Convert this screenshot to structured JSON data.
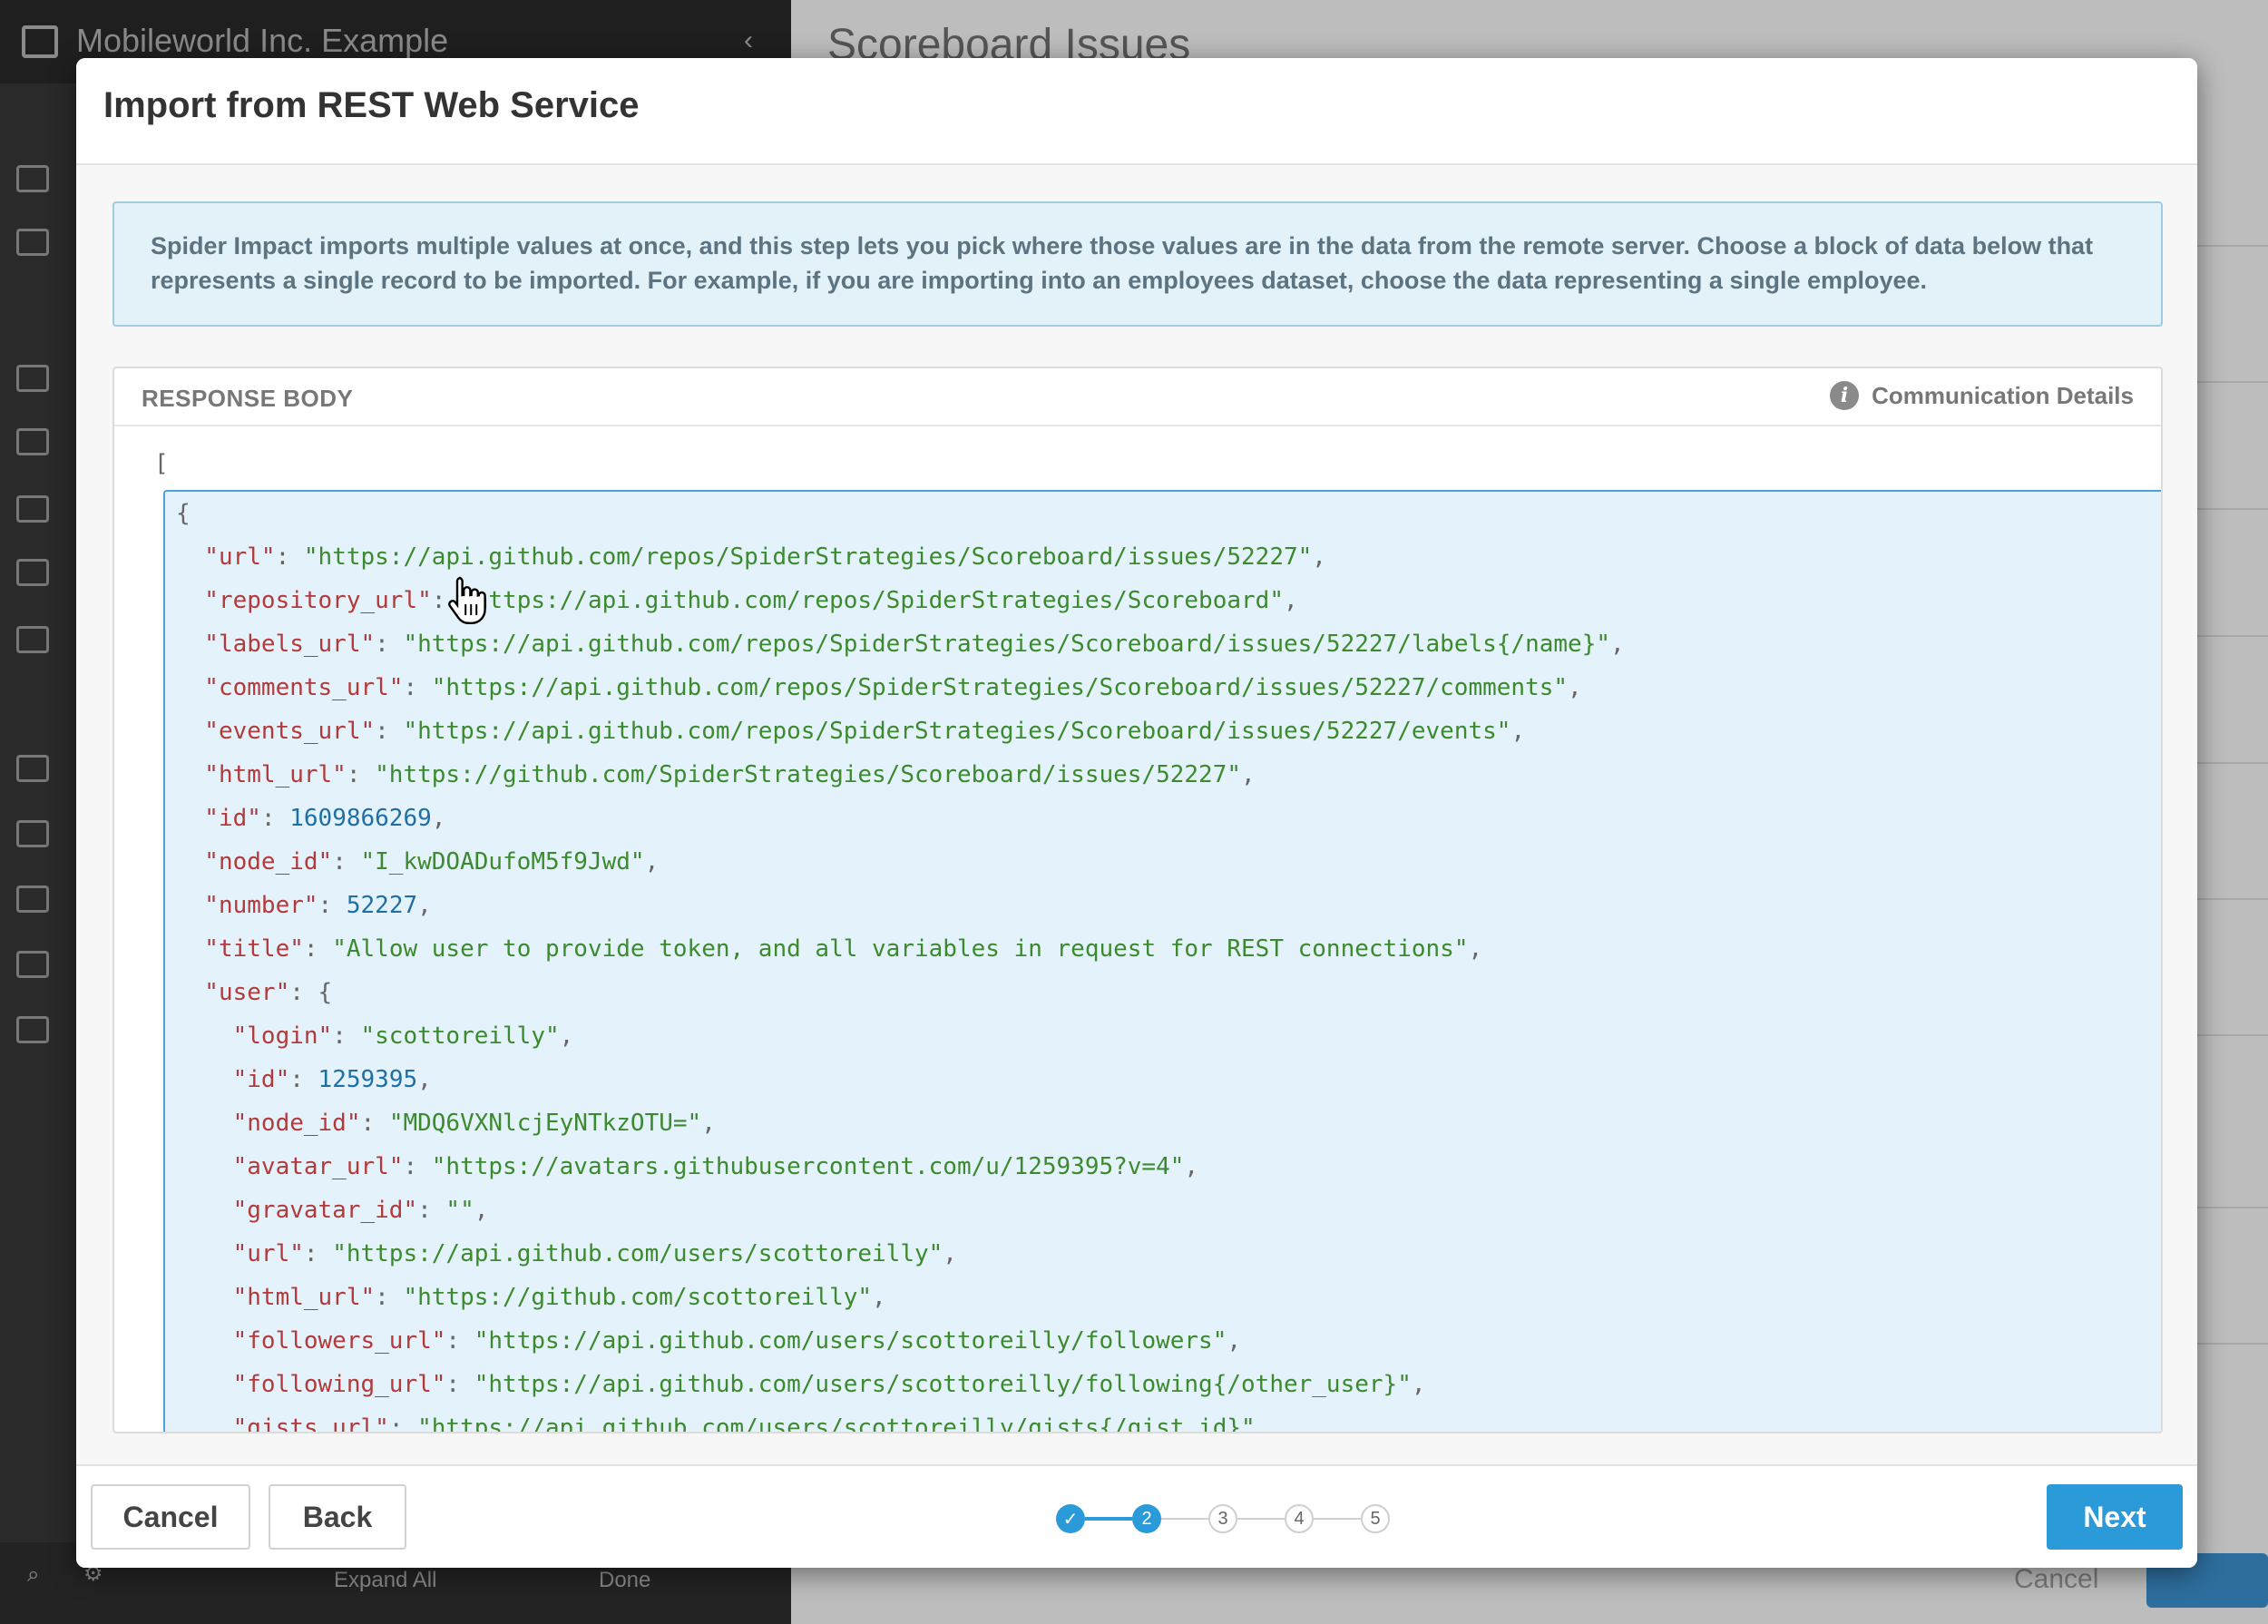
{
  "background": {
    "app_name": "Mobileworld Inc. Example",
    "page_title": "Scoreboard Issues",
    "bottom_bar": {
      "expand_all": "Expand All",
      "done": "Done",
      "cancel": "Cancel"
    }
  },
  "modal": {
    "title": "Import from REST Web Service",
    "info_text": "Spider Impact imports multiple values at once, and this step lets you pick where those values are in the data from the remote server. Choose a block of data below that represents a single record to be imported. For example, if you are importing into an employees dataset, choose the data representing a single employee.",
    "panel_title": "RESPONSE BODY",
    "communication_details": "Communication Details",
    "open_bracket": "[",
    "record_lines": [
      [
        {
          "t": "p",
          "v": "{"
        }
      ],
      [
        {
          "t": "k",
          "v": "  \"url\""
        },
        {
          "t": "p",
          "v": ": "
        },
        {
          "t": "s",
          "v": "\"https://api.github.com/repos/SpiderStrategies/Scoreboard/issues/52227\""
        },
        {
          "t": "p",
          "v": ","
        }
      ],
      [
        {
          "t": "k",
          "v": "  \"repository_url\""
        },
        {
          "t": "p",
          "v": ": "
        },
        {
          "t": "s",
          "v": "\"https://api.github.com/repos/SpiderStrategies/Scoreboard\""
        },
        {
          "t": "p",
          "v": ","
        }
      ],
      [
        {
          "t": "k",
          "v": "  \"labels_url\""
        },
        {
          "t": "p",
          "v": ": "
        },
        {
          "t": "s",
          "v": "\"https://api.github.com/repos/SpiderStrategies/Scoreboard/issues/52227/labels{/name}\""
        },
        {
          "t": "p",
          "v": ","
        }
      ],
      [
        {
          "t": "k",
          "v": "  \"comments_url\""
        },
        {
          "t": "p",
          "v": ": "
        },
        {
          "t": "s",
          "v": "\"https://api.github.com/repos/SpiderStrategies/Scoreboard/issues/52227/comments\""
        },
        {
          "t": "p",
          "v": ","
        }
      ],
      [
        {
          "t": "k",
          "v": "  \"events_url\""
        },
        {
          "t": "p",
          "v": ": "
        },
        {
          "t": "s",
          "v": "\"https://api.github.com/repos/SpiderStrategies/Scoreboard/issues/52227/events\""
        },
        {
          "t": "p",
          "v": ","
        }
      ],
      [
        {
          "t": "k",
          "v": "  \"html_url\""
        },
        {
          "t": "p",
          "v": ": "
        },
        {
          "t": "s",
          "v": "\"https://github.com/SpiderStrategies/Scoreboard/issues/52227\""
        },
        {
          "t": "p",
          "v": ","
        }
      ],
      [
        {
          "t": "k",
          "v": "  \"id\""
        },
        {
          "t": "p",
          "v": ": "
        },
        {
          "t": "n",
          "v": "1609866269"
        },
        {
          "t": "p",
          "v": ","
        }
      ],
      [
        {
          "t": "k",
          "v": "  \"node_id\""
        },
        {
          "t": "p",
          "v": ": "
        },
        {
          "t": "s",
          "v": "\"I_kwDOADufoM5f9Jwd\""
        },
        {
          "t": "p",
          "v": ","
        }
      ],
      [
        {
          "t": "k",
          "v": "  \"number\""
        },
        {
          "t": "p",
          "v": ": "
        },
        {
          "t": "n",
          "v": "52227"
        },
        {
          "t": "p",
          "v": ","
        }
      ],
      [
        {
          "t": "k",
          "v": "  \"title\""
        },
        {
          "t": "p",
          "v": ": "
        },
        {
          "t": "s",
          "v": "\"Allow user to provide token, and all variables in request for REST connections\""
        },
        {
          "t": "p",
          "v": ","
        }
      ],
      [
        {
          "t": "k",
          "v": "  \"user\""
        },
        {
          "t": "p",
          "v": ": {"
        }
      ],
      [
        {
          "t": "k",
          "v": "    \"login\""
        },
        {
          "t": "p",
          "v": ": "
        },
        {
          "t": "s",
          "v": "\"scottoreilly\""
        },
        {
          "t": "p",
          "v": ","
        }
      ],
      [
        {
          "t": "k",
          "v": "    \"id\""
        },
        {
          "t": "p",
          "v": ": "
        },
        {
          "t": "n",
          "v": "1259395"
        },
        {
          "t": "p",
          "v": ","
        }
      ],
      [
        {
          "t": "k",
          "v": "    \"node_id\""
        },
        {
          "t": "p",
          "v": ": "
        },
        {
          "t": "s",
          "v": "\"MDQ6VXNlcjEyNTkzOTU=\""
        },
        {
          "t": "p",
          "v": ","
        }
      ],
      [
        {
          "t": "k",
          "v": "    \"avatar_url\""
        },
        {
          "t": "p",
          "v": ": "
        },
        {
          "t": "s",
          "v": "\"https://avatars.githubusercontent.com/u/1259395?v=4\""
        },
        {
          "t": "p",
          "v": ","
        }
      ],
      [
        {
          "t": "k",
          "v": "    \"gravatar_id\""
        },
        {
          "t": "p",
          "v": ": "
        },
        {
          "t": "s",
          "v": "\"\""
        },
        {
          "t": "p",
          "v": ","
        }
      ],
      [
        {
          "t": "k",
          "v": "    \"url\""
        },
        {
          "t": "p",
          "v": ": "
        },
        {
          "t": "s",
          "v": "\"https://api.github.com/users/scottoreilly\""
        },
        {
          "t": "p",
          "v": ","
        }
      ],
      [
        {
          "t": "k",
          "v": "    \"html_url\""
        },
        {
          "t": "p",
          "v": ": "
        },
        {
          "t": "s",
          "v": "\"https://github.com/scottoreilly\""
        },
        {
          "t": "p",
          "v": ","
        }
      ],
      [
        {
          "t": "k",
          "v": "    \"followers_url\""
        },
        {
          "t": "p",
          "v": ": "
        },
        {
          "t": "s",
          "v": "\"https://api.github.com/users/scottoreilly/followers\""
        },
        {
          "t": "p",
          "v": ","
        }
      ],
      [
        {
          "t": "k",
          "v": "    \"following_url\""
        },
        {
          "t": "p",
          "v": ": "
        },
        {
          "t": "s",
          "v": "\"https://api.github.com/users/scottoreilly/following{/other_user}\""
        },
        {
          "t": "p",
          "v": ","
        }
      ],
      [
        {
          "t": "k",
          "v": "    \"gists_url\""
        },
        {
          "t": "p",
          "v": ": "
        },
        {
          "t": "s",
          "v": "\"https://api.github.com/users/scottoreilly/gists{/gist_id}\""
        },
        {
          "t": "p",
          "v": ","
        }
      ]
    ]
  },
  "footer": {
    "cancel_label": "Cancel",
    "back_label": "Back",
    "next_label": "Next",
    "steps": [
      {
        "label": "✓",
        "state": "done"
      },
      {
        "label": "2",
        "state": "active"
      },
      {
        "label": "3",
        "state": "todo"
      },
      {
        "label": "4",
        "state": "todo"
      },
      {
        "label": "5",
        "state": "todo"
      }
    ]
  },
  "colors": {
    "accent": "#2b9ad8",
    "json_key": "#b33a3a",
    "json_string": "#3c8a2e",
    "json_number": "#1f6fa5",
    "info_bg": "#e3f1f9",
    "record_bg": "#e4f2fb"
  }
}
